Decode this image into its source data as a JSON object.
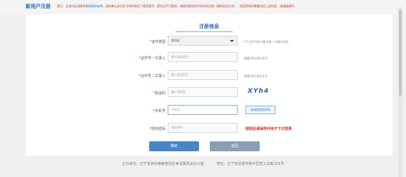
{
  "header": {
    "title": "新用户注册",
    "tip_prefix": "提示：无身份证请联系",
    "tip_link": "联络您的老师",
    "tip_suffix": "，请在确认身份证号码的情况下规范填写，提交后不可更改，请使用常用的手机号码注册（通知发送方式），找回密码时需要验证上述信息，请谨慎填写。"
  },
  "form": {
    "title": "注册信息",
    "fields": [
      {
        "label": "证件类型",
        "value": "身份证",
        "hint": "1个证件号码只能注册一次报名信息"
      },
      {
        "label": "证件号一次录入",
        "placeholder": "输入身份证号",
        "hint": "请输18位身份证号"
      },
      {
        "label": "证件号二次录入",
        "placeholder": "输入身份证号",
        "hint": "请输18位身份证号"
      },
      {
        "label": "验证码",
        "placeholder": "输入验证码",
        "captcha": "XYh4"
      },
      {
        "label": "手机号",
        "placeholder": "手机号",
        "button": "发送短信验证码"
      },
      {
        "label": "短信密码",
        "placeholder": "短信密码",
        "warning": "获取后请保存并用于下次登录"
      }
    ],
    "confirm_label": "确定",
    "back_label": "返回"
  },
  "footer": {
    "organizer": "主办单位：辽宁省高中等教育招生考试委员会办公室",
    "address": "地址：辽宁省沈阳市和平区智工北街101号"
  }
}
